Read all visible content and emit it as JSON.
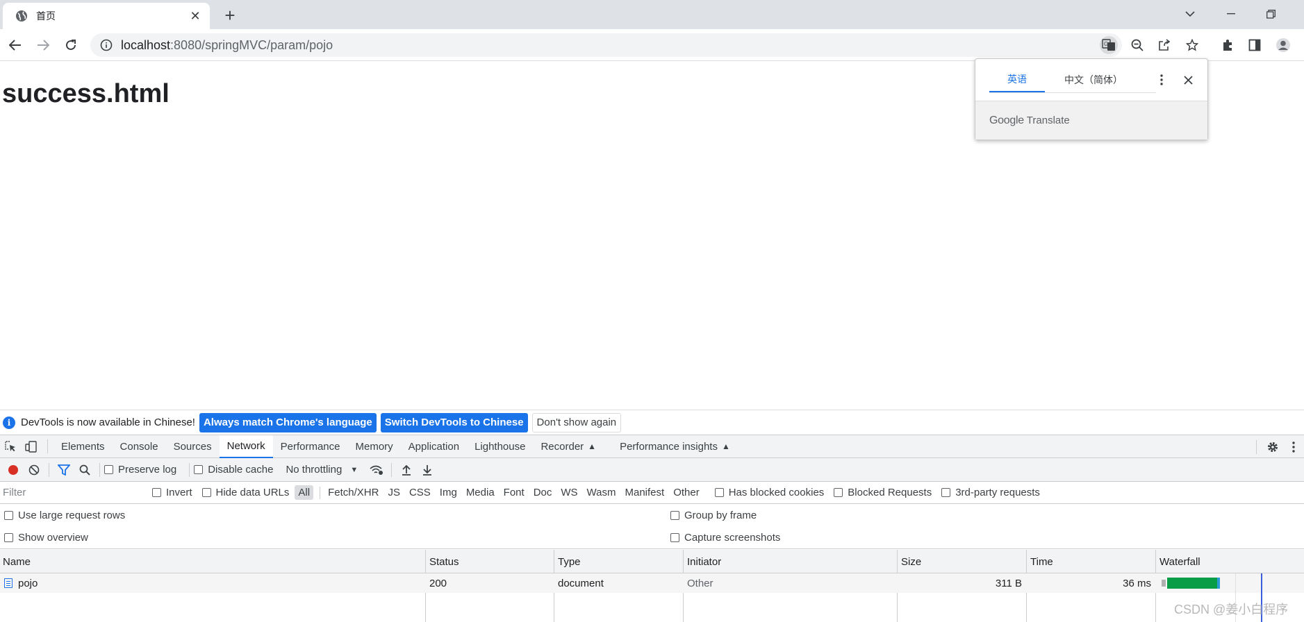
{
  "browser": {
    "tab_title": "首页",
    "url_host": "localhost",
    "url_rest": ":8080/springMVC/param/pojo"
  },
  "page": {
    "heading": "success.html"
  },
  "translate_popup": {
    "tab_source": "英语",
    "tab_target": "中文（简体）",
    "brand_google": "Google",
    "brand_translate": "Translate"
  },
  "devtools_banner": {
    "message": "DevTools is now available in Chinese!",
    "btn_match": "Always match Chrome's language",
    "btn_switch": "Switch DevTools to Chinese",
    "btn_dismiss": "Don't show again"
  },
  "devtools_tabs": [
    "Elements",
    "Console",
    "Sources",
    "Network",
    "Performance",
    "Memory",
    "Application",
    "Lighthouse",
    "Recorder",
    "Performance insights"
  ],
  "network_toolbar": {
    "preserve_log": "Preserve log",
    "disable_cache": "Disable cache",
    "throttling": "No throttling"
  },
  "filter_row": {
    "placeholder": "Filter",
    "invert": "Invert",
    "hide_data_urls": "Hide data URLs",
    "types": [
      "All",
      "Fetch/XHR",
      "JS",
      "CSS",
      "Img",
      "Media",
      "Font",
      "Doc",
      "WS",
      "Wasm",
      "Manifest",
      "Other"
    ],
    "has_blocked_cookies": "Has blocked cookies",
    "blocked_requests": "Blocked Requests",
    "third_party": "3rd-party requests"
  },
  "options": {
    "large_rows": "Use large request rows",
    "show_overview": "Show overview",
    "group_by_frame": "Group by frame",
    "capture_screenshots": "Capture screenshots"
  },
  "table": {
    "columns": [
      "Name",
      "Status",
      "Type",
      "Initiator",
      "Size",
      "Time",
      "Waterfall"
    ],
    "rows": [
      {
        "name": "pojo",
        "status": "200",
        "type": "document",
        "initiator": "Other",
        "size": "311 B",
        "time": "36 ms"
      }
    ]
  },
  "watermark": "CSDN @姜小白程序",
  "colors": {
    "accent": "#1a73e8",
    "record": "#d93025",
    "waterfall_green": "#0a9d47"
  }
}
